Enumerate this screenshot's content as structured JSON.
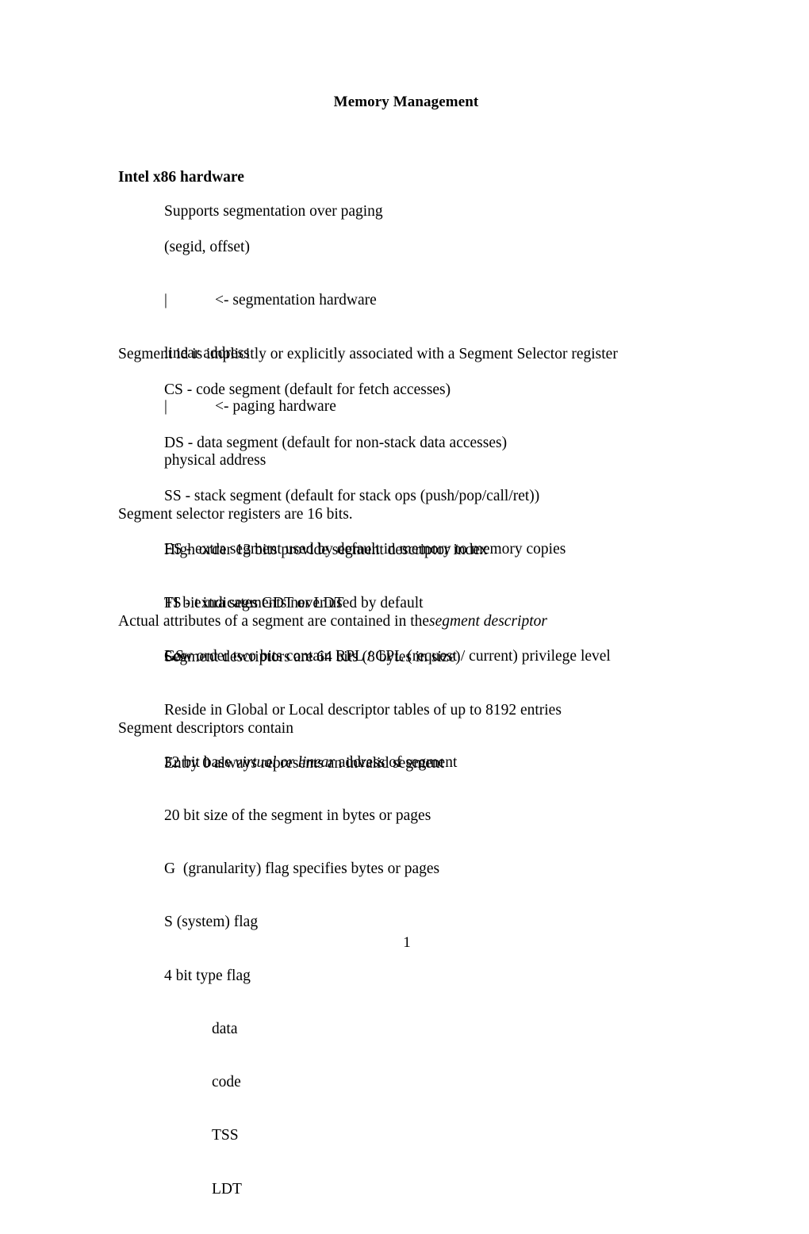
{
  "document": {
    "title": "Memory Management",
    "page_number": "1",
    "section_heading": "Intel x86 hardware",
    "blocks": {
      "supports": "Supports segmentation over paging",
      "diagram": {
        "line1": "(segid, offset)",
        "line2_pipe": "|",
        "line2_arrow": "<- segmentation hardware",
        "line3": "linear address",
        "line4_pipe": "|",
        "line4_arrow": "<- paging hardware",
        "line5": "physical address"
      },
      "segment_id_intro": "Segment id is implicitly or explicitly associated with a Segment Selector register",
      "registers": {
        "cs": "CS - code segment (default for fetch accesses)",
        "ds": "DS - data segment (default for non-stack data accesses)",
        "ss": "SS - stack segment (default for stack ops (push/pop/call/ret))",
        "es": "ES - extra segment used by default in memory to memory copies",
        "fs": "FS - extra segments never used by default",
        "gs": "GS"
      },
      "selector_intro": "Segment selector registers are 16 bits.",
      "selector_bits": {
        "high": "High order 13 bits provide segment descriptor index",
        "ti": "TI bit indicates GDT or LDT",
        "low": "Low order two bits contain RPL / CPL (request / current) privilege level"
      },
      "attributes_intro_plain": "Actual attributes of a segment are contained in the",
      "attributes_intro_italic": "segment descriptor",
      "descriptor_facts": {
        "size": "Segment descriptors are 64 bits (8 bytes in size)",
        "reside": "Reside in Global or Local descriptor tables of up to 8192 entries",
        "entry0": "Entry 0 always represents an invalid segment"
      },
      "contain_intro": "Segment descriptors contain",
      "contents": {
        "base_pre": "32 bit base ",
        "base_italic": "virtual or linear",
        "base_post": " address of segment",
        "size": "20 bit size of the segment in bytes or pages",
        "granularity": "G  (granularity) flag specifies bytes or pages",
        "system": "S (system) flag",
        "type_flag": "4 bit type flag",
        "type_values": {
          "data": "data",
          "code": "code",
          "tss": "TSS",
          "ldt": "LDT"
        }
      }
    }
  }
}
